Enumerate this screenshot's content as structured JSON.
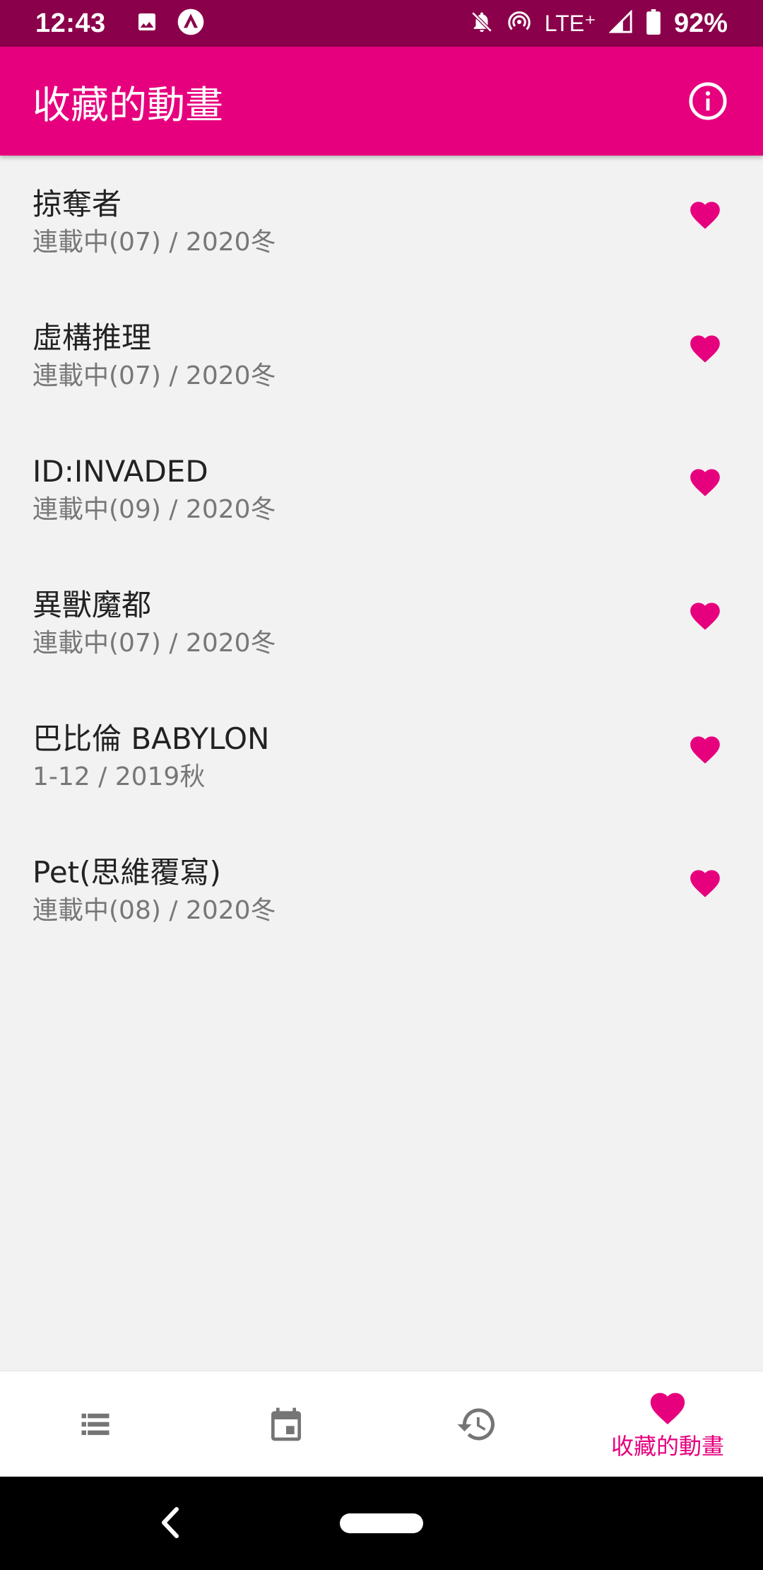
{
  "status": {
    "time": "12:43",
    "network": "LTE⁺",
    "battery": "92%",
    "icons": [
      "image-icon",
      "app-notification-icon",
      "mute-icon",
      "hotspot-icon",
      "signal-icon",
      "battery-icon"
    ]
  },
  "app_bar": {
    "title": "收藏的動畫",
    "info_icon": "info-icon"
  },
  "favorites": [
    {
      "title": "掠奪者",
      "subtitle": "連載中(07) / 2020冬"
    },
    {
      "title": "虛構推理",
      "subtitle": "連載中(07) / 2020冬"
    },
    {
      "title": "ID:INVADED",
      "subtitle": "連載中(09) / 2020冬"
    },
    {
      "title": "異獸魔都",
      "subtitle": "連載中(07) / 2020冬"
    },
    {
      "title": "巴比倫 BABYLON",
      "subtitle": "1-12 / 2019秋"
    },
    {
      "title": "Pet(思維覆寫)",
      "subtitle": "連載中(08) / 2020冬"
    }
  ],
  "bottom_nav": {
    "items": [
      {
        "icon": "list-icon",
        "label": ""
      },
      {
        "icon": "calendar-icon",
        "label": ""
      },
      {
        "icon": "history-icon",
        "label": ""
      },
      {
        "icon": "heart-icon",
        "label": "收藏的動畫",
        "active": true
      }
    ]
  },
  "colors": {
    "accent": "#e6007e",
    "status_bar": "#8a004a",
    "background": "#f2f2f2",
    "inactive_icon": "#757575"
  }
}
